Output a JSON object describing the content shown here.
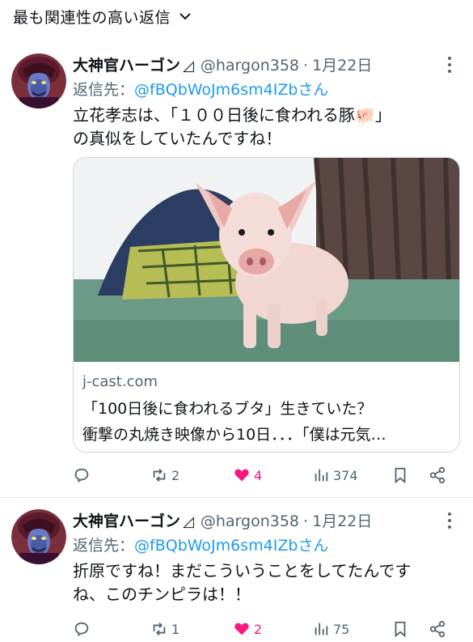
{
  "sort": {
    "label": "最も関連性の高い返信",
    "icon": "chevron-down-icon"
  },
  "tweets": [
    {
      "display_name": "大神官ハーゴン",
      "verified_mark": "◿",
      "handle": "@hargon358",
      "separator": "·",
      "date": "1月22日",
      "reply_label": "返信先：",
      "reply_target": "@fBQbWoJm6sm4IZbさん",
      "text_line1": "立花孝志は、「１００日後に食われる豚🐖」",
      "text_line2": "の真似をしていたんですね！",
      "card": {
        "domain": "j-cast.com",
        "title_line1": "「100日後に食われるブタ」生きていた？",
        "title_line2": "衝撃の丸焼き映像から10日．．．「僕は元気…"
      },
      "stats": {
        "replies": "",
        "retweets": "2",
        "likes": "4",
        "views": "374"
      }
    },
    {
      "display_name": "大神官ハーゴン",
      "verified_mark": "◿",
      "handle": "@hargon358",
      "separator": "·",
      "date": "1月22日",
      "reply_label": "返信先：",
      "reply_target": "@fBQbWoJm6sm4IZbさん",
      "text_line1": "折原ですね！まだこういうことをしてたんです",
      "text_line2": "ね、このチンピラは！！",
      "stats": {
        "replies": "",
        "retweets": "1",
        "likes": "2",
        "views": "75"
      }
    }
  ],
  "colors": {
    "link": "#1d9bf0",
    "like": "#f91880",
    "muted": "#536471",
    "text": "#0f1419"
  }
}
